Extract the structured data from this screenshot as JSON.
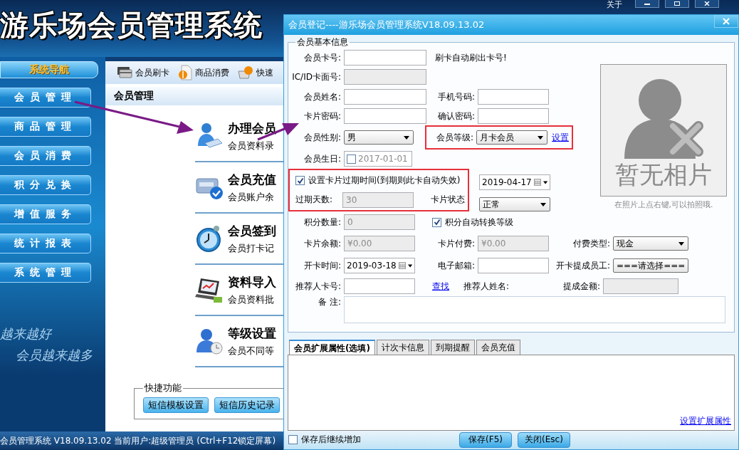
{
  "app": {
    "title": "游乐场会员管理系统",
    "about": "关于"
  },
  "sidebar": {
    "title": "系统导航",
    "items": [
      {
        "label": "会员管理"
      },
      {
        "label": "商品管理"
      },
      {
        "label": "会员消费"
      },
      {
        "label": "积分兑换"
      },
      {
        "label": "增值服务"
      },
      {
        "label": "统计报表"
      },
      {
        "label": "系统管理"
      }
    ],
    "slogans": [
      "越来越好",
      "会员越来越多"
    ]
  },
  "toolbar": [
    {
      "kind": "card",
      "label": "会员刷卡"
    },
    {
      "kind": "dollar",
      "label": "商品消费"
    },
    {
      "kind": "basket",
      "label": "快速"
    }
  ],
  "content": {
    "title": "会员管理",
    "items": [
      {
        "kind": "register",
        "title": "办理会员",
        "desc": "会员资料录"
      },
      {
        "kind": "recharge",
        "title": "会员充值",
        "desc": "会员账户余"
      },
      {
        "kind": "checkin",
        "title": "会员签到",
        "desc": "会员打卡记"
      },
      {
        "kind": "import",
        "title": "资料导入",
        "desc": "会员资料批"
      },
      {
        "kind": "level",
        "title": "等级设置",
        "desc": "会员不同等"
      }
    ]
  },
  "quick": {
    "title": "快捷功能",
    "buttons": [
      "短信模板设置",
      "短信历史记录"
    ]
  },
  "status_bar": "会员管理系统 V18.09.13.02 当前用户:超级管理员 (Ctrl+F12锁定屏幕)",
  "dialog": {
    "title": "会员登记----游乐场会员管理系统V18.09.13.02",
    "group": "会员基本信息",
    "card_no": {
      "label": "会员卡号:",
      "kind": "text",
      "disabled": false
    },
    "card_hint": "刷卡自动刷出卡号!",
    "ic_no": {
      "label": "IC/ID卡面号:",
      "kind": "text",
      "disabled": true
    },
    "name": {
      "label": "会员姓名:",
      "kind": "text",
      "disabled": false
    },
    "phone": {
      "label": "手机号码:",
      "kind": "text",
      "disabled": false
    },
    "password": {
      "label": "卡片密码:",
      "kind": "text",
      "disabled": false
    },
    "confirm": {
      "label": "确认密码:",
      "kind": "text",
      "disabled": false
    },
    "gender": {
      "label": "会员性别:",
      "kind": "select",
      "value": "男"
    },
    "level": {
      "label": "会员等级:",
      "kind": "select",
      "value": "月卡会员"
    },
    "level_link": "设置",
    "birthday": {
      "label": "会员生日:",
      "kind": "date",
      "value": "2017-01-01",
      "checked": false,
      "disabled": true
    },
    "expiry": {
      "label": "设置卡片过期时间(到期则此卡自动失效)",
      "checked": true
    },
    "expiry_date": {
      "kind": "date",
      "value": "2019-04-17",
      "disabled": false
    },
    "expiry_days": {
      "label": "过期天数:",
      "kind": "text",
      "value": "30",
      "disabled": true
    },
    "card_status": {
      "label": "卡片状态",
      "kind": "select",
      "value": "正常"
    },
    "points": {
      "label": "积分数量:",
      "kind": "text",
      "value": "0",
      "disabled": true
    },
    "auto_level": {
      "label": "积分自动转换等级",
      "checked": true
    },
    "photo": {
      "text": "暂无相片",
      "caption": "在照片上点右键,可以拍照哦."
    },
    "balance": {
      "label": "卡片余额:",
      "kind": "text",
      "value": "¥0.00",
      "disabled": true
    },
    "card_fee": {
      "label": "卡片付费:",
      "kind": "text",
      "value": "¥0.00",
      "disabled": true
    },
    "pay_type": {
      "label": "付费类型:",
      "kind": "select",
      "value": "现金"
    },
    "open_date": {
      "label": "开卡时间:",
      "kind": "date",
      "value": "2019-03-18",
      "disabled": false
    },
    "email": {
      "label": "电子邮箱:",
      "kind": "text",
      "disabled": false
    },
    "staff": {
      "label": "开卡提成员工:",
      "kind": "select",
      "value": "===请选择==="
    },
    "referrer_no": {
      "label": "推荐人卡号:",
      "kind": "text",
      "disabled": false
    },
    "find_link": "查找",
    "referrer_name": {
      "label": "推荐人姓名:"
    },
    "commission": {
      "label": "提成金额:",
      "kind": "text",
      "disabled": true
    },
    "remark": {
      "label": "备 注:"
    },
    "tabs": [
      {
        "label": "会员扩展属性(选填)",
        "selected": true
      },
      {
        "label": "计次卡信息",
        "selected": false
      },
      {
        "label": "到期提醒",
        "selected": false
      },
      {
        "label": "会员充值",
        "selected": false
      }
    ],
    "tab_link": "设置扩展属性",
    "continue": {
      "label": "保存后继续增加",
      "checked": false
    },
    "buttons": [
      "保存(F5)",
      "关闭(Esc)"
    ]
  }
}
